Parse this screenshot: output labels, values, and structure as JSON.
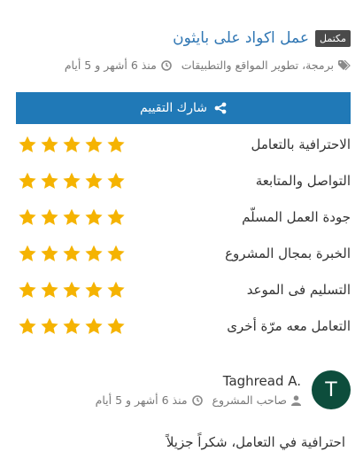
{
  "project": {
    "status_badge": "مكتمل",
    "title": "عمل اكواد على بايثون",
    "category": "برمجة، تطوير المواقع والتطبيقات",
    "time_ago": "منذ 6 أشهر و 5 أيام"
  },
  "share": {
    "label": "شارك التقييم",
    "icon": "share-icon"
  },
  "ratings": [
    {
      "label": "الاحترافية بالتعامل",
      "stars": 5
    },
    {
      "label": "التواصل والمتابعة",
      "stars": 5
    },
    {
      "label": "جودة العمل المسلّم",
      "stars": 5
    },
    {
      "label": "الخبرة بمجال المشروع",
      "stars": 5
    },
    {
      "label": "التسليم فى الموعد",
      "stars": 5
    },
    {
      "label": "التعامل معه مرّة أخرى",
      "stars": 5
    }
  ],
  "colors": {
    "accent": "#2079b7",
    "star": "#f5b301",
    "avatar": "#0d4d3c",
    "title": "#2f76b3"
  },
  "review": {
    "avatar_letter": "T",
    "name": "Taghread A.",
    "role": "صاحب المشروع",
    "time_ago": "منذ 6 أشهر و 5 أيام",
    "text": "احترافية في التعامل، شكراً جزيلاً"
  }
}
